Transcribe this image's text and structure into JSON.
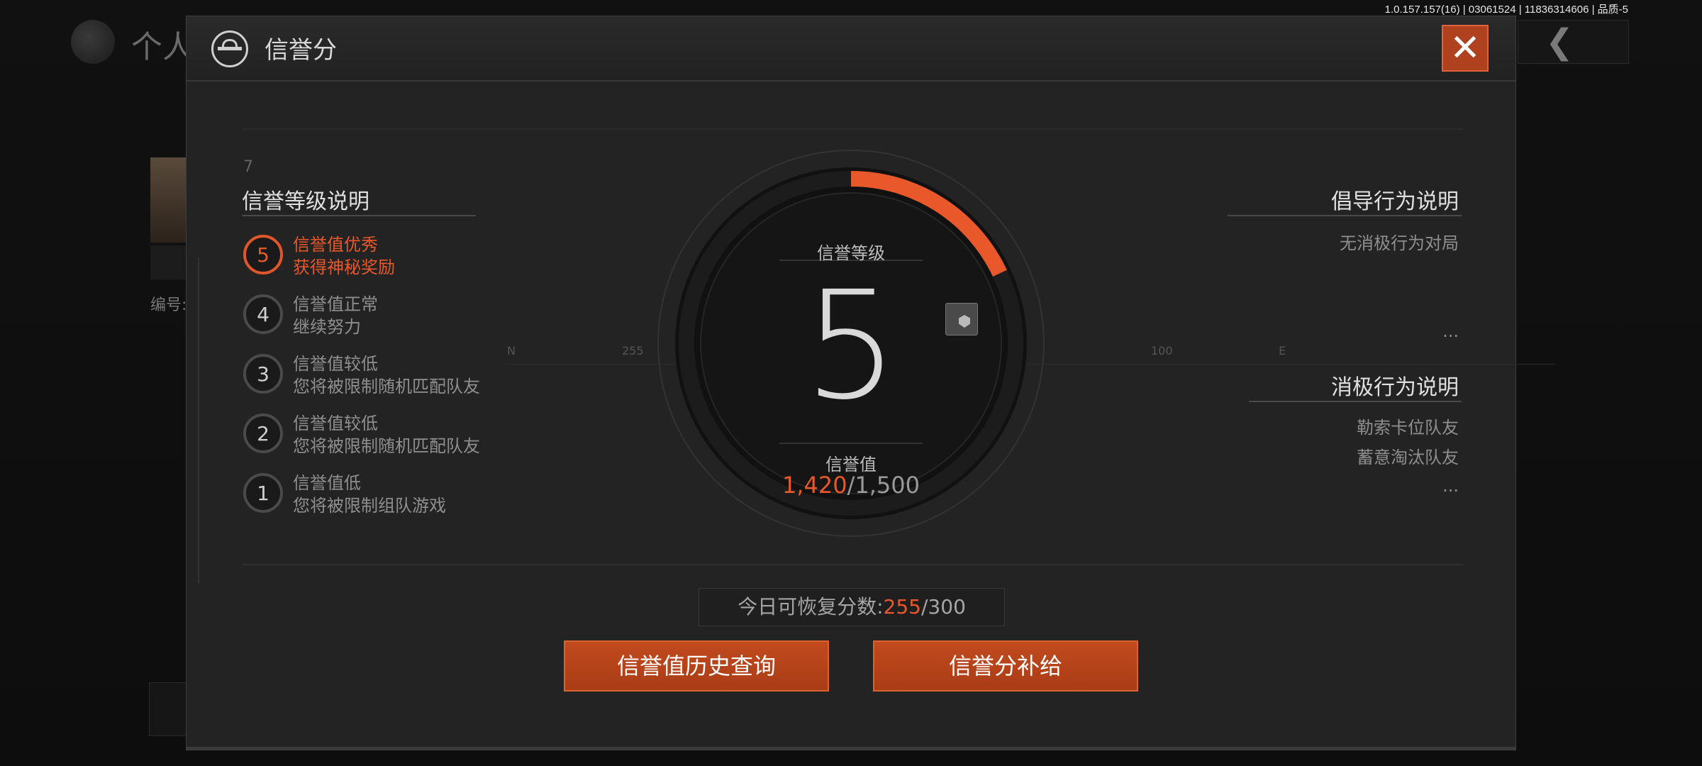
{
  "version_text": "1.0.157.157(16) | 03061524 | 11836314606 | 品质-5",
  "background": {
    "title": "个人",
    "code_label": "编号:"
  },
  "modal": {
    "title": "信誉分",
    "close_icon": "close-icon",
    "left": {
      "title": "信誉等级说明",
      "tiny_number": "7",
      "levels": [
        {
          "num": "5",
          "title": "信誉值优秀",
          "desc": "获得神秘奖励",
          "active": true
        },
        {
          "num": "4",
          "title": "信誉值正常",
          "desc": "继续努力",
          "active": false
        },
        {
          "num": "3",
          "title": "信誉值较低",
          "desc": "您将被限制随机匹配队友",
          "active": false
        },
        {
          "num": "2",
          "title": "信誉值较低",
          "desc": "您将被限制随机匹配队友",
          "active": false
        },
        {
          "num": "1",
          "title": "信誉值低",
          "desc": "您将被限制组队游戏",
          "active": false
        }
      ]
    },
    "dial": {
      "level_label": "信誉等级",
      "level_value": "5",
      "score_label": "信誉值",
      "score_current": "1,420",
      "score_max": "/1,500",
      "progress_fraction": 0.18,
      "accent_color": "#e8582a",
      "axis_labels": [
        "N",
        "255",
        "100",
        "E"
      ]
    },
    "right": {
      "encourage_title": "倡导行为说明",
      "encourage_items": [
        "无消极行为对局"
      ],
      "negative_title": "消极行为说明",
      "negative_items": [
        "勒索卡位队友",
        "蓄意淘汰队友"
      ],
      "more": "..."
    },
    "recover": {
      "label": "今日可恢复分数:",
      "current": "255",
      "max": "/300"
    },
    "buttons": {
      "history": "信誉值历史查询",
      "supplement": "信誉分补给"
    }
  }
}
